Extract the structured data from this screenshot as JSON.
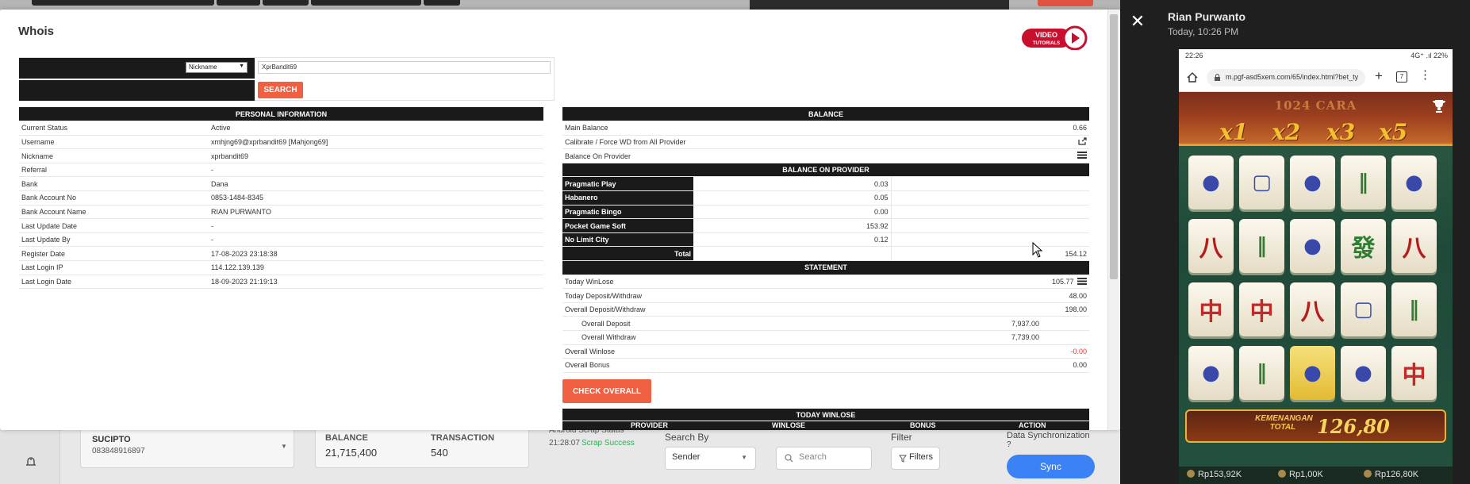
{
  "modal": {
    "title": "Whois",
    "video_badge": {
      "line1": "VIDEO",
      "line2": "TUTORIALS"
    },
    "search": {
      "select_value": "Nickname",
      "input_value": "XprBandit69",
      "button_label": "SEARCH"
    },
    "personal": {
      "header": "PERSONAL INFORMATION",
      "rows": [
        {
          "label": "Current Status",
          "value": "Active"
        },
        {
          "label": "Username",
          "value": "xmhjng69@xprbandit69  [Mahjong69]"
        },
        {
          "label": "Nickname",
          "value": "xprbandit69"
        },
        {
          "label": "Referral",
          "value": "-"
        },
        {
          "label": "Bank",
          "value": "Dana"
        },
        {
          "label": "Bank Account No",
          "value": "0853-1484-8345"
        },
        {
          "label": "Bank Account Name",
          "value": "RIAN PURWANTO"
        },
        {
          "label": "Last Update Date",
          "value": "-"
        },
        {
          "label": "Last Update By",
          "value": "-"
        },
        {
          "label": "Register Date",
          "value": "17-08-2023 23:18:38"
        },
        {
          "label": "Last Login IP",
          "value": "114.122.139.139"
        },
        {
          "label": "Last Login Date",
          "value": "18-09-2023 21:19:13"
        }
      ]
    },
    "balance": {
      "header": "BALANCE",
      "main_balance_label": "Main Balance",
      "main_balance_value": "0.66",
      "calibrate_label": "Calibrate / Force WD from All Provider",
      "on_provider_label": "Balance On Provider",
      "provider_header": "BALANCE ON PROVIDER",
      "providers": [
        {
          "name": "Pragmatic Play",
          "value": "0.03"
        },
        {
          "name": "Habanero",
          "value": "0.05"
        },
        {
          "name": "Pragmatic Bingo",
          "value": "0.00"
        },
        {
          "name": "Pocket Game Soft",
          "value": "153.92"
        },
        {
          "name": "No Limit City",
          "value": "0.12"
        }
      ],
      "total_label": "Total",
      "total_value": "154.12"
    },
    "statement": {
      "header": "STATEMENT",
      "today_winlose_label": "Today WinLose",
      "today_winlose_value": "105.77",
      "today_dw_label": "Today Deposit/Withdraw",
      "today_dw_value": "48.00",
      "overall_dw_label": "Overall Deposit/Withdraw",
      "overall_dw_value": "198.00",
      "overall_deposit_label": "Overall Deposit",
      "overall_deposit_value": "7,937.00",
      "overall_withdraw_label": "Overall Withdraw",
      "overall_withdraw_value": "7,739.00",
      "overall_winlose_label": "Overall Winlose",
      "overall_winlose_value": "-0.00",
      "overall_bonus_label": "Overall Bonus",
      "overall_bonus_value": "0.00"
    },
    "check_overall_label": "CHECK OVERALL",
    "today_winlose": {
      "header": "TODAY WINLOSE",
      "columns": [
        "PROVIDER",
        "WINLOSE",
        "BONUS",
        "ACTION"
      ]
    }
  },
  "background": {
    "user_name": "SUCIPTO",
    "user_phone": "083848916897",
    "balance_label": "BALANCE",
    "balance_value": "21,715,400",
    "transaction_label": "TRANSACTION",
    "transaction_value": "540",
    "scrap_title": "Android Scrap Status",
    "scrap_time": "21:28:07",
    "scrap_status": "Scrap Success",
    "search_by_label": "Search By",
    "search_by_value": "Sender",
    "search_placeholder": "Search",
    "filter_label": "Filter",
    "filters_button": "Filters",
    "sync_label": "Data Synchronization",
    "sync_button": "Sync"
  },
  "viewer": {
    "sender_name": "Rian Purwanto",
    "sender_time": "Today, 10:26 PM",
    "phone": {
      "clock": "22:26",
      "status_right": "4G⁺ .ıl 22%",
      "url": "m.pgf-asd5xem.com/65/index.html?bet_ty",
      "tab_count": "7",
      "game": {
        "mode": "1024 CARA",
        "multipliers": [
          "x1",
          "x2",
          "x3",
          "x5"
        ],
        "win_label": "KEMENANGAN TOTAL",
        "win_amount": "126,80",
        "footer": {
          "balance": "Rp153,92K",
          "bet": "Rp1,00K",
          "win": "Rp126,80K"
        }
      }
    }
  },
  "colors": {
    "accent": "#ef5f41",
    "header_dark": "#1a1a1a",
    "sync_blue": "#3b82f6",
    "negative": "#e33333"
  }
}
